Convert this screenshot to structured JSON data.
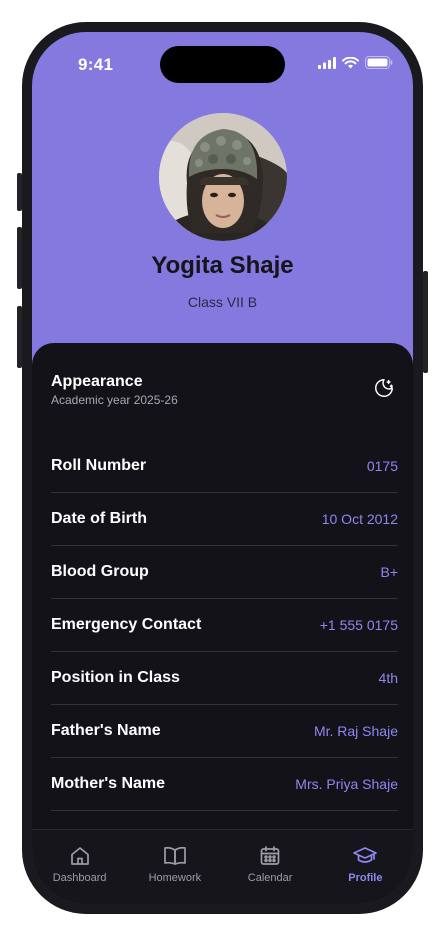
{
  "status_bar": {
    "time": "9:41"
  },
  "profile": {
    "name": "Yogita Shaje",
    "class_label": "Class VII B"
  },
  "appearance": {
    "title": "Appearance",
    "subtitle": "Academic year 2025-26",
    "icon": "moon-stars-icon"
  },
  "details": [
    {
      "label": "Roll Number",
      "value": "0175"
    },
    {
      "label": "Date of Birth",
      "value": "10 Oct 2012"
    },
    {
      "label": "Blood Group",
      "value": "B+"
    },
    {
      "label": "Emergency Contact",
      "value": "+1 555 0175"
    },
    {
      "label": "Position in Class",
      "value": "4th"
    },
    {
      "label": "Father's Name",
      "value": "Mr. Raj Shaje"
    },
    {
      "label": "Mother's Name",
      "value": "Mrs. Priya Shaje"
    }
  ],
  "tabs": [
    {
      "label": "Dashboard",
      "icon": "home-icon",
      "active": false
    },
    {
      "label": "Homework",
      "icon": "book-icon",
      "active": false
    },
    {
      "label": "Calendar",
      "icon": "calendar-icon",
      "active": false
    },
    {
      "label": "Profile",
      "icon": "graduation-cap-icon",
      "active": true
    }
  ],
  "colors": {
    "header_bg": "#8479df",
    "sheet_bg": "#131219",
    "accent": "#8f87f0"
  }
}
